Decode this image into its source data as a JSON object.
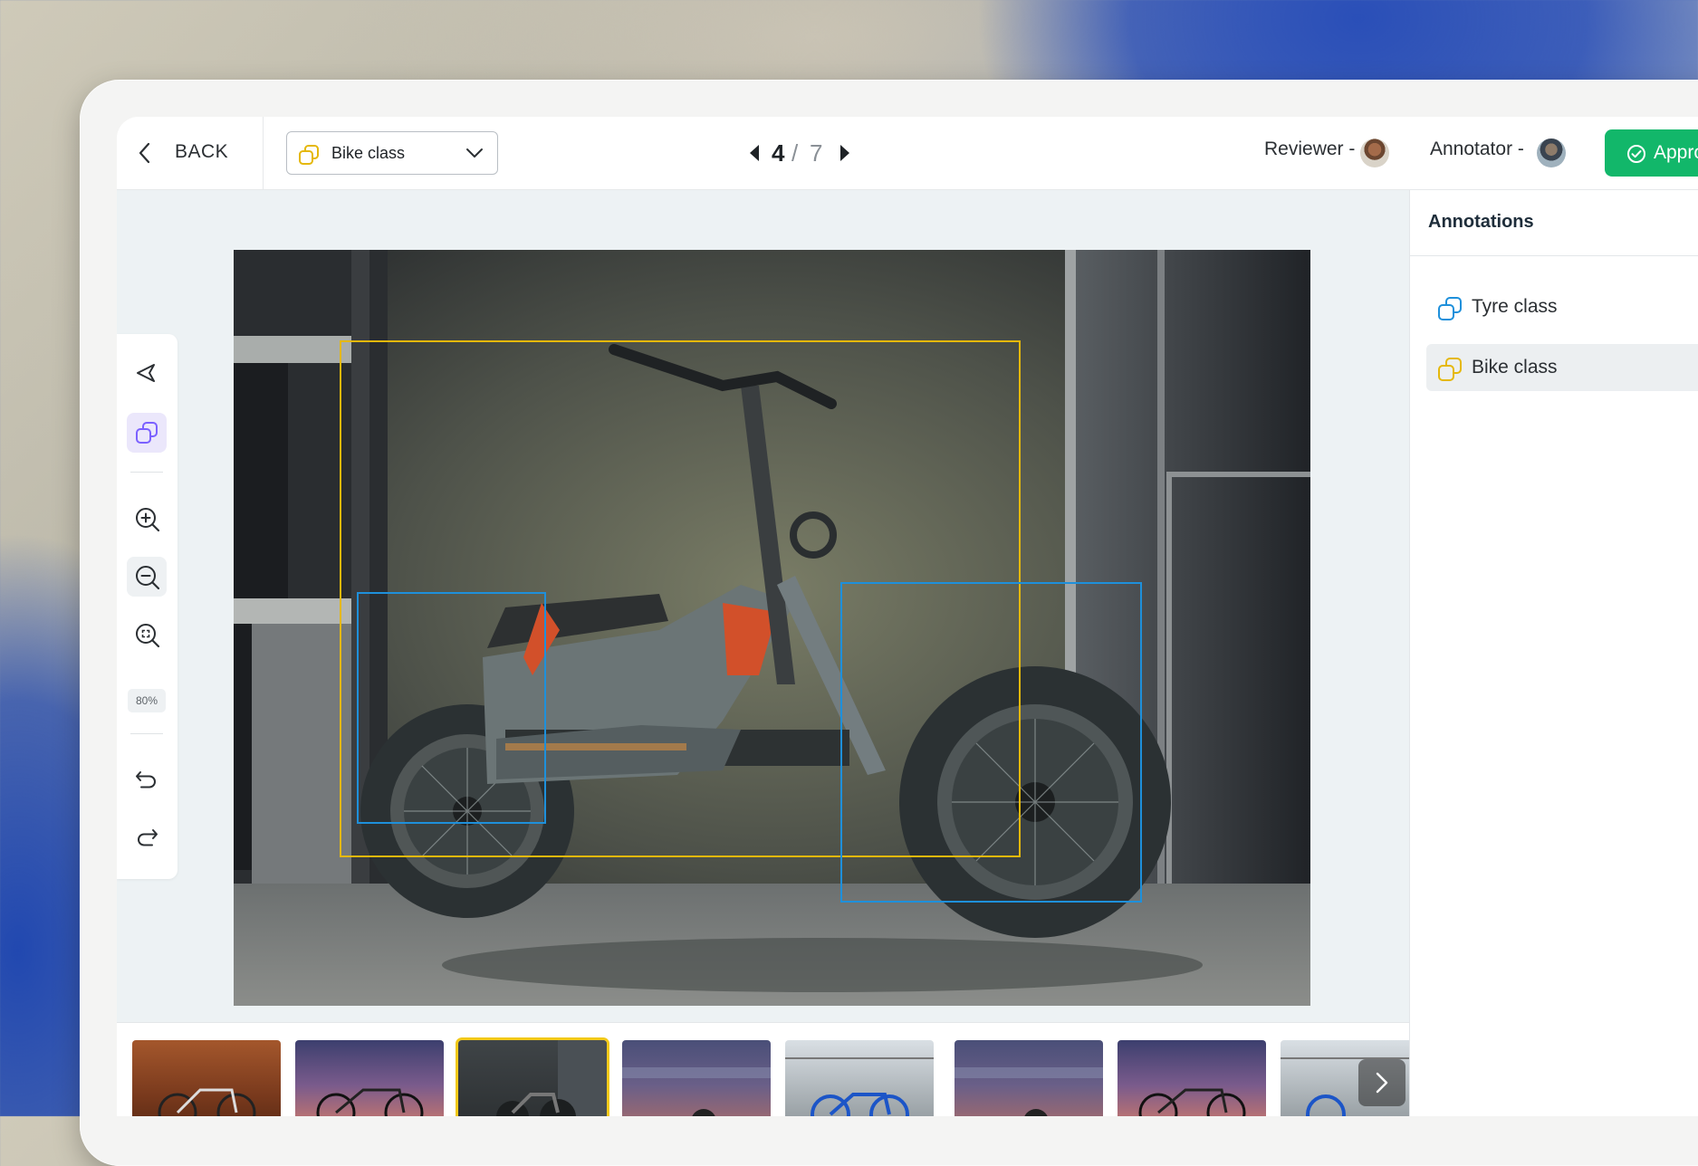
{
  "header": {
    "back_label": "BACK",
    "class_selector": {
      "value": "Bike class",
      "icon": "class-shape-icon",
      "icon_color": "#e5b80b"
    },
    "pager": {
      "current": "4",
      "separator": "/",
      "total": "7"
    },
    "reviewer_label": "Reviewer -",
    "annotator_label": "Annotator -",
    "approve_label": "Approve",
    "approve_color": "#12b76a"
  },
  "toolbar": {
    "tools": [
      "pointer-icon",
      "bbox-class-icon",
      "zoom-in-icon",
      "zoom-out-icon",
      "zoom-fit-icon",
      "undo-icon",
      "redo-icon"
    ],
    "zoom_level": "80%"
  },
  "annotations": {
    "title": "Annotations",
    "items": [
      {
        "label": "Tyre class",
        "color": "#1e90db"
      },
      {
        "label": "Bike class",
        "color": "#e5b80b",
        "selected": true
      }
    ]
  },
  "filmstrip": {
    "count": 8,
    "selected_index": 2
  },
  "colors": {
    "accent": "#7b61ff",
    "bike_box": "#e5b80b",
    "tyre_box": "#1e90db"
  }
}
